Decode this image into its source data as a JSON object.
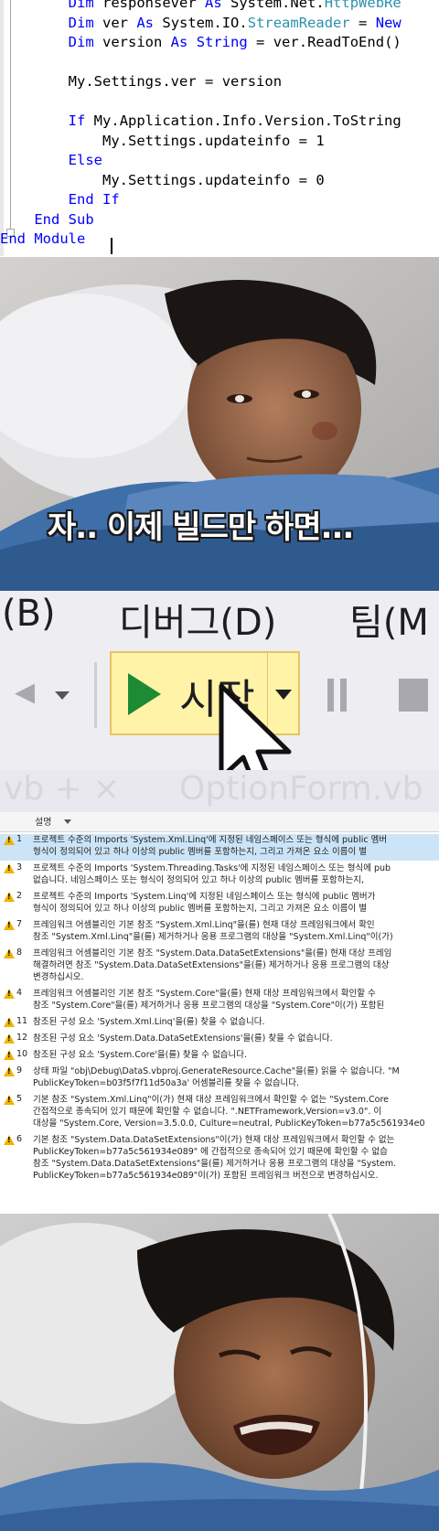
{
  "code": {
    "lines": [
      "        Dim responsever As System.Net.HttpWebRe",
      "        Dim ver As System.IO.StreamReader = New",
      "        Dim version As String = ver.ReadToEnd()",
      "",
      "        My.Settings.ver = version",
      "",
      "        If My.Application.Info.Version.ToString",
      "            My.Settings.updateinfo = 1",
      "        Else",
      "            My.Settings.updateinfo = 0",
      "        End If",
      "    End Sub",
      "End Module"
    ]
  },
  "scene1": {
    "subtitle": "자.. 이제 빌드만 하면..."
  },
  "toolbar": {
    "menu_build": "(B)",
    "menu_debug": "디버그(D)",
    "menu_team": "팀(M",
    "start_label": "시작",
    "tab_left_ghost": "vb  + × ",
    "tab_right_ghost": "OptionForm.vb"
  },
  "error_list": {
    "header_label": "설명",
    "rows": [
      {
        "num": "1",
        "lines": [
          "프로젝트 수준의 Imports 'System.Xml.Linq'에 지정된 네임스페이스 또는 형식에 public 멤버",
          "형식이 정의되어 있고 하나 이상의 public 멤버를 포함하는지, 그리고 가져온 요소 이름이 별"
        ]
      },
      {
        "num": "3",
        "lines": [
          "프로젝트 수준의 Imports 'System.Threading.Tasks'에 지정된 네임스페이스 또는 형식에 pub",
          "없습니다. 네임스페이스 또는 형식이 정의되어 있고 하나 이상의 public 멤버를 포함하는지,"
        ]
      },
      {
        "num": "2",
        "lines": [
          "프로젝트 수준의 Imports 'System.Linq'에 지정된 네임스페이스 또는 형식에 public 멤버가",
          "형식이 정의되어 있고 하나 이상의 public 멤버를 포함하는지, 그리고 가져온 요소 이름이 별"
        ]
      },
      {
        "num": "7",
        "lines": [
          "프레임워크 어셈블리인 기본 참조 \"System.Xml.Linq\"을(를) 현재 대상 프레임워크에서 확인",
          "참조 \"System.Xml.Linq\"을(를) 제거하거나 응용 프로그램의 대상을 \"System.Xml.Linq\"이(가)"
        ]
      },
      {
        "num": "8",
        "lines": [
          "프레임워크 어셈블리인 기본 참조 \"System.Data.DataSetExtensions\"을(를) 현재 대상 프레임",
          "해결하려면 참조 \"System.Data.DataSetExtensions\"을(를) 제거하거나 응용 프로그램의 대상",
          "변경하십시오."
        ]
      },
      {
        "num": "4",
        "lines": [
          "프레임워크 어셈블리인 기본 참조 \"System.Core\"을(를) 현재 대상 프레임워크에서 확인할 수",
          "참조 \"System.Core\"을(를) 제거하거나 응용 프로그램의 대상을 \"System.Core\"이(가) 포함된"
        ]
      },
      {
        "num": "11",
        "lines": [
          "참조된 구성 요소 'System.Xml.Linq'을(를) 찾을 수 없습니다."
        ]
      },
      {
        "num": "12",
        "lines": [
          "참조된 구성 요소 'System.Data.DataSetExtensions'을(를) 찾을 수 없습니다."
        ]
      },
      {
        "num": "10",
        "lines": [
          "참조된 구성 요소 'System.Core'을(를) 찾을 수 없습니다."
        ]
      },
      {
        "num": "9",
        "lines": [
          "상태 파일 \"obj\\Debug\\DataS.vbproj.GenerateResource.Cache\"을(를) 읽을 수 없습니다. \"M",
          "PublicKeyToken=b03f5f7f11d50a3a' 어셈블리를 찾을 수 없습니다."
        ]
      },
      {
        "num": "5",
        "lines": [
          "기본 참조 \"System.Xml.Linq\"이(가) 현재 대상 프레임워크에서 확인할 수 없는 \"System.Core",
          "간접적으로 종속되어 있기 때문에 확인할 수 없습니다. \".NETFramework,Version=v3.0\". 이",
          "대상을 \"System.Core, Version=3.5.0.0, Culture=neutral, PublicKeyToken=b77a5c561934e0"
        ]
      },
      {
        "num": "6",
        "lines": [
          "기본 참조 \"System.Data.DataSetExtensions\"이(가) 현재 대상 프레임워크에서 확인할 수 없는",
          "PublicKeyToken=b77a5c561934e089\" 에 간접적으로 종속되어 있기 때문에 확인할 수 없습",
          "참조 \"System.Data.DataSetExtensions\"을(를) 제거하거나 응용 프로그램의 대상을 \"System.",
          "PublicKeyToken=b77a5c561934e089\"이(가) 포함된 프레임워크 버전으로 변경하십시오."
        ]
      }
    ]
  },
  "colors": {
    "code_keyword": "#0000ff",
    "code_type": "#2b91af",
    "start_button_bg": "#fff3a8",
    "play_green": "#1d8a34",
    "warning_yellow": "#f0b400",
    "selected_row": "#cce4f7"
  }
}
